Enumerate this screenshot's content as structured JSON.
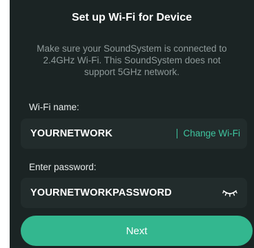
{
  "header": {
    "title": "Set up Wi-Fi for Device"
  },
  "notice": {
    "line1": "Make sure your SoundSystem is connected to",
    "line2": "2.4GHz Wi-Fi. This SoundSystem does not",
    "line3": "support 5GHz network."
  },
  "wifi_name": {
    "label": "Wi-Fi name:",
    "value": "YOURNETWORK",
    "change_label": "Change Wi-Fi"
  },
  "password": {
    "label": "Enter password:",
    "value": "YOURNETWORKPASSWORD",
    "toggle_icon": "eye-closed-icon"
  },
  "next": {
    "label": "Next"
  },
  "colors": {
    "background": "#1b2424",
    "field_background": "#222c2c",
    "accent": "#3fc6a0",
    "button": "#33b78f"
  }
}
